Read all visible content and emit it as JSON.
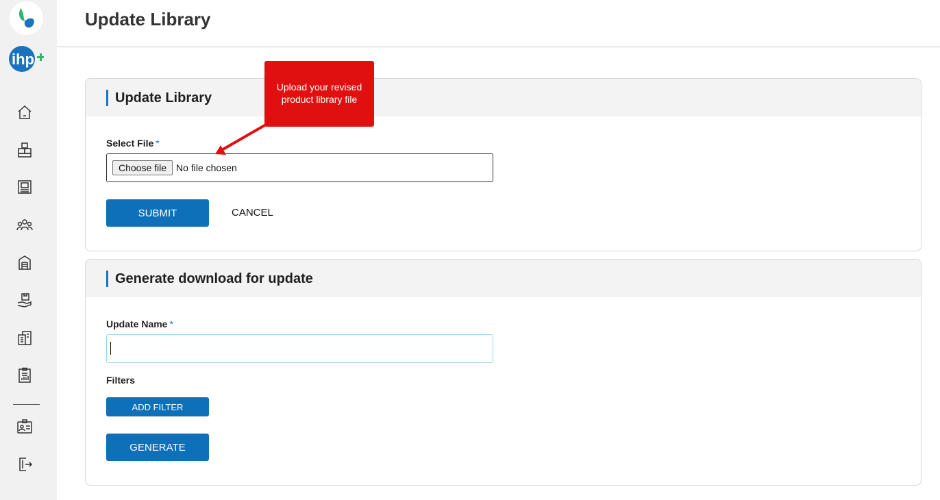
{
  "app": {
    "page_title": "Update Library"
  },
  "sidebar": {
    "items": [
      {
        "icon": "home-icon"
      },
      {
        "icon": "boxes-icon"
      },
      {
        "icon": "catalog-icon"
      },
      {
        "icon": "users-group-icon"
      },
      {
        "icon": "warehouse-icon"
      },
      {
        "icon": "hand-package-icon"
      },
      {
        "icon": "reports-icon"
      },
      {
        "icon": "clipboard-chart-icon"
      },
      {
        "icon": "profile-card-icon"
      },
      {
        "icon": "logout-icon"
      }
    ]
  },
  "update_card": {
    "title": "Update Library",
    "select_file_label": "Select File",
    "required_mark": "*",
    "choose_file_label": "Choose file",
    "no_file_text": "No file chosen",
    "submit_label": "SUBMIT",
    "cancel_label": "CANCEL"
  },
  "callout": {
    "text": "Upload your revised product library file"
  },
  "generate_card": {
    "title": "Generate download for update",
    "update_name_label": "Update Name",
    "required_mark": "*",
    "update_name_value": "",
    "filters_label": "Filters",
    "add_filter_label": "ADD FILTER",
    "generate_label": "GENERATE"
  },
  "colors": {
    "primary": "#0d70b8",
    "callout": "#e11010",
    "accent_bar": "#1a73be"
  }
}
